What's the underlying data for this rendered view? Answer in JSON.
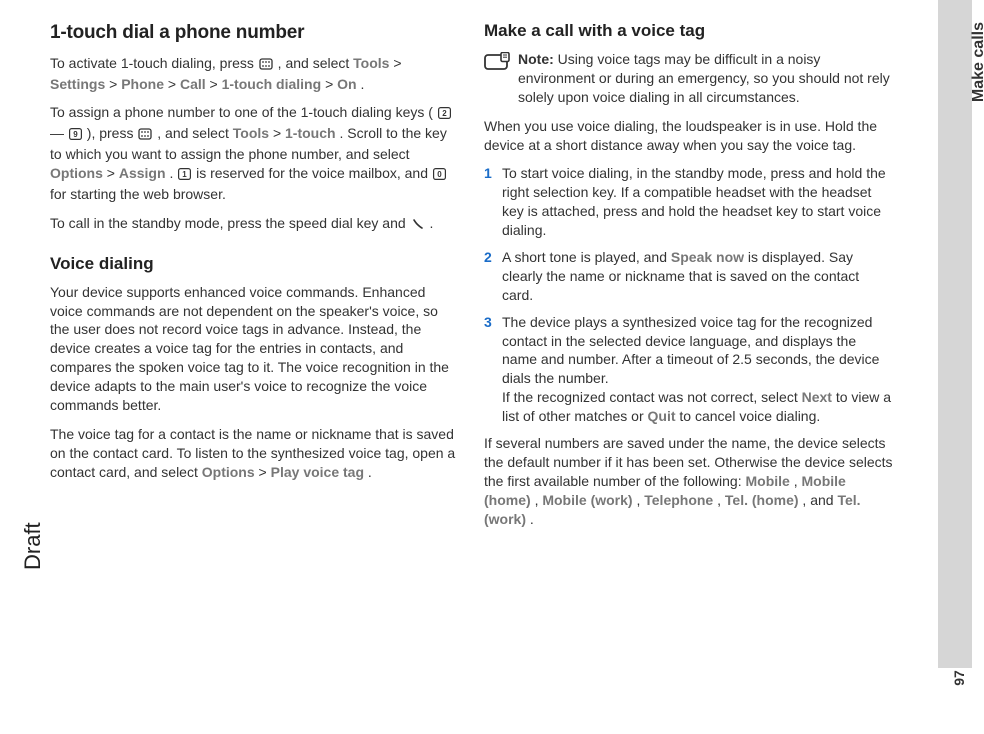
{
  "sideTab": "Make calls",
  "pageNum": "97",
  "draft": "Draft",
  "left": {
    "h1": "1-touch dial a phone number",
    "p1a": "To activate 1-touch dialing, press ",
    "p1b": " , and select ",
    "p1c": "Tools",
    "p1d": " > ",
    "p1e": "Settings",
    "p1f": " > ",
    "p1g": "Phone",
    "p1h": " > ",
    "p1i": "Call",
    "p1j": " > ",
    "p1k": "1-touch dialing",
    "p1l": " > ",
    "p1m": "On",
    "p1n": ".",
    "p2a": "To assign a phone number to one of the 1-touch dialing keys (",
    "p2b": " — ",
    "p2c": "), press ",
    "p2d": " , and select ",
    "p2e": "Tools",
    "p2f": " > ",
    "p2g": "1-touch",
    "p2h": ". Scroll to the key to which you want to assign the phone number, and select ",
    "p2i": "Options",
    "p2j": " > ",
    "p2k": "Assign",
    "p2l": ".  ",
    "p2m": " is reserved for the voice mailbox, and ",
    "p2n": " for starting the web browser.",
    "p3a": "To call in the standby mode, press the speed dial key and ",
    "p3b": " .",
    "h2": "Voice dialing",
    "p4": "Your device supports enhanced voice commands. Enhanced voice commands are not dependent on the speaker's voice, so the user does not record voice tags in advance. Instead, the device creates a voice tag for the entries in contacts, and compares the spoken voice tag to it. The voice recognition in the device adapts to the main user's voice to recognize the voice commands better.",
    "p5a": "The voice tag for a contact is the name or nickname that is saved on the contact card. To listen to the synthesized voice tag, open a contact card, and select ",
    "p5b": "Options",
    "p5c": " > ",
    "p5d": "Play voice tag",
    "p5e": "."
  },
  "right": {
    "h1": "Make a call with a voice tag",
    "noteLabel": "Note:",
    "noteText": " Using voice tags may be difficult in a noisy environment or during an emergency, so you should not rely solely upon voice dialing in all circumstances.",
    "p1": "When you use voice dialing, the loudspeaker is in use. Hold the device at a short distance away when you say the voice tag.",
    "s1n": "1",
    "s1": "To start voice dialing, in the standby mode, press and hold the right selection key. If a compatible headset with the headset key is attached, press and hold the headset key to start voice dialing.",
    "s2n": "2",
    "s2a": "A short tone is played, and ",
    "s2b": "Speak now",
    "s2c": " is displayed. Say clearly the name or nickname that is saved on the contact card.",
    "s3n": "3",
    "s3a": "The device plays a synthesized voice tag for the recognized contact in the selected device language, and displays the name and number. After a timeout of 2.5 seconds, the device dials the number.",
    "s3b": "If the recognized contact was not correct, select ",
    "s3c": "Next",
    "s3d": " to view a list of other matches or ",
    "s3e": "Quit",
    "s3f": " to cancel voice dialing.",
    "p2a": "If several numbers are saved under the name, the device selects the default number if it has been set. Otherwise the device selects the first available number of the following: ",
    "p2b": "Mobile",
    "p2c": ", ",
    "p2d": "Mobile (home)",
    "p2e": ", ",
    "p2f": "Mobile (work)",
    "p2g": ", ",
    "p2h": "Telephone",
    "p2i": ", ",
    "p2j": "Tel. (home)",
    "p2k": ", and ",
    "p2l": "Tel. (work)",
    "p2m": "."
  }
}
